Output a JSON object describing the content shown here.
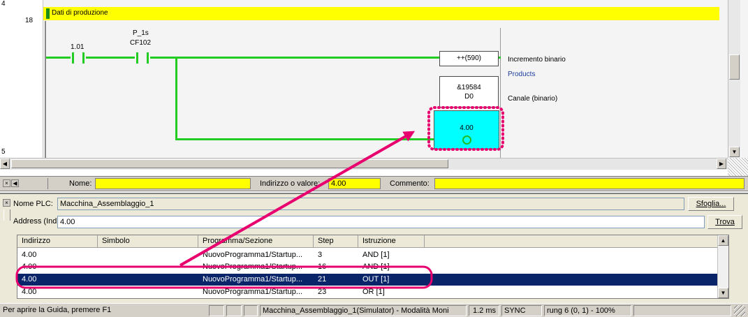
{
  "ladder": {
    "rung_prev_number": "4",
    "rung_number": "18",
    "rung_next_number": "5",
    "rung_title": "Dati di produzione",
    "contact1": {
      "address": "1.01"
    },
    "contact2": {
      "symbol": "P_1s",
      "address": "CF102"
    },
    "instruction": {
      "name": "++(590)",
      "description": "Incremento binario"
    },
    "operand": {
      "label": "&19584",
      "address": "D0",
      "comment": "Canale (binario)",
      "symbol": "Products"
    },
    "coil": {
      "address": "4.00"
    }
  },
  "watch": {
    "name_label": "Nome:",
    "name_value": "",
    "address_label": "Indirizzo o valore:",
    "address_value": "4.00",
    "comment_label": "Commento:",
    "comment_value": ""
  },
  "search": {
    "plc_label": "Nome PLC:",
    "plc_value": "Macchina_Assemblaggio_1",
    "browse_label": "Sfoglia...",
    "address_label": "Address (Indiriz",
    "address_value": "4.00",
    "find_label": "Trova",
    "columns": [
      "Indirizzo",
      "Simbolo",
      "Programma/Sezione",
      "Step",
      "Istruzione"
    ],
    "rows": [
      {
        "indirizzo": "4.00",
        "simbolo": "",
        "programma": "NuovoProgramma1/Startup...",
        "step": "3",
        "istruzione": "AND [1]"
      },
      {
        "indirizzo": "4.00",
        "simbolo": "",
        "programma": "NuovoProgramma1/Startup...",
        "step": "16",
        "istruzione": "AND [1]"
      },
      {
        "indirizzo": "4.00",
        "simbolo": "",
        "programma": "NuovoProgramma1/Startup...",
        "step": "21",
        "istruzione": "OUT [1]"
      },
      {
        "indirizzo": "4.00",
        "simbolo": "",
        "programma": "NuovoProgramma1/Startup...",
        "step": "23",
        "istruzione": "OR [1]"
      }
    ]
  },
  "status": {
    "help": "Per aprire la Guida, premere F1",
    "mode": "Macchina_Assemblaggio_1(Simulator) - Modalità Moni",
    "cycle": "1.2 ms",
    "sync": "SYNC",
    "position": "rung 6 (0, 1)  - 100%"
  },
  "colors": {
    "wire": "#22cc22",
    "coil_fill": "#00ffff",
    "highlight": "#e8006e",
    "rung_bar": "#ffff00",
    "selection": "#0a246a"
  }
}
